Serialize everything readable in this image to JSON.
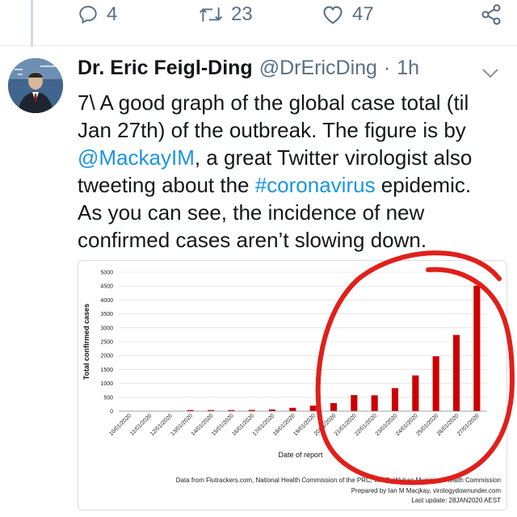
{
  "actions": {
    "reply_count": "4",
    "retweet_count": "23",
    "like_count": "47",
    "icons": [
      "reply-icon",
      "retweet-icon",
      "like-icon",
      "share-icon"
    ]
  },
  "tweet": {
    "author_name": "Dr. Eric Feigl-Ding",
    "handle": "@DrEricDing",
    "separator": "·",
    "time": "1h",
    "text_before_mention": "7\\ A good graph of the global case total (til Jan 27th) of the outbreak. The figure is by ",
    "mention": "@MackayIM",
    "text_middle": ", a great Twitter virologist also tweeting about the ",
    "hashtag": "#coronavirus",
    "text_after": " epidemic. As you can see, the incidence of new confirmed cases aren’t slowing down."
  },
  "chart_data": {
    "type": "bar",
    "ylabel": "Total confirmed cases",
    "xlabel": "Date of report",
    "ylim": [
      0,
      5000
    ],
    "yticks": [
      0,
      500,
      1000,
      1500,
      2000,
      2500,
      3000,
      3500,
      4000,
      4500,
      5000
    ],
    "categories": [
      "10/01/2020",
      "11/01/2020",
      "12/01/2020",
      "13/01/2020",
      "14/01/2020",
      "15/01/2020",
      "16/01/2020",
      "17/01/2020",
      "18/01/2020",
      "19/01/2020",
      "20/01/2020",
      "21/01/2020",
      "22/01/2020",
      "23/01/2020",
      "24/01/2020",
      "25/01/2020",
      "26/01/2020",
      "27/01/2020"
    ],
    "values": [
      0,
      0,
      0,
      41,
      41,
      41,
      45,
      62,
      121,
      198,
      291,
      580,
      571,
      830,
      1287,
      1975,
      2744,
      4515
    ],
    "bar_color": "#cc0000",
    "grid": true,
    "footer": [
      "Data from Flutrackers.com, National Health Commission of the PRC, WHO, Wuhan Municipal Health Commission",
      "Prepared by Ian M Macjkay, virologydownunder.com",
      "Last update: 28JAN2020 AEST"
    ]
  },
  "annotation_color": "#e0201b"
}
